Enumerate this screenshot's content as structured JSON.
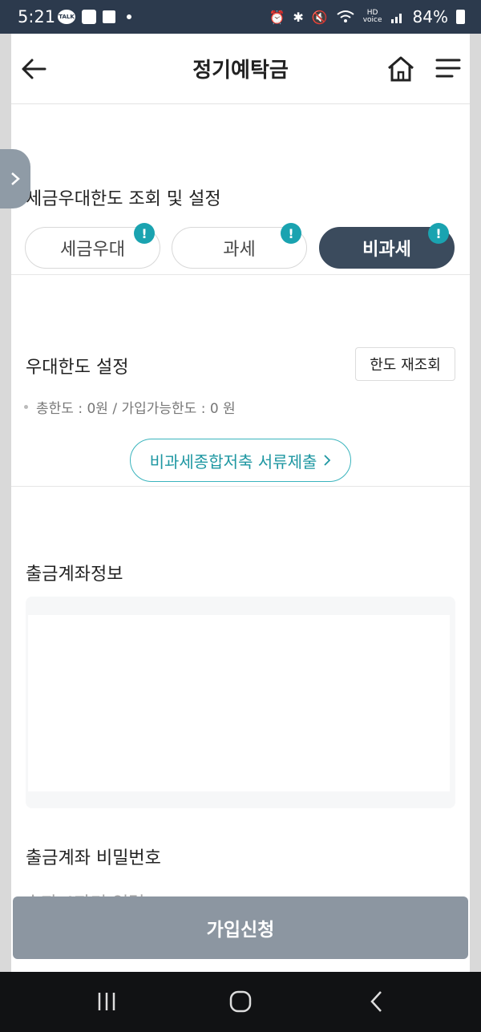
{
  "status_bar": {
    "time": "5:21",
    "battery": "84%",
    "left_icons": [
      "talk-icon",
      "image-icon",
      "flag-icon",
      "dot-icon"
    ],
    "right_icons": [
      "alarm-icon",
      "bluetooth-icon",
      "mute-icon",
      "wifi-icon",
      "hd-voice-icon",
      "signal-icon",
      "battery-icon"
    ]
  },
  "header": {
    "title": "정기예탁금",
    "back_icon": "back-arrow-icon",
    "home_icon": "home-icon",
    "menu_icon": "hamburger-menu-icon"
  },
  "tax_section": {
    "title": "세금우대한도 조회 및 설정",
    "options": [
      {
        "label": "세금우대",
        "selected": false,
        "badge": "!"
      },
      {
        "label": "과세",
        "selected": false,
        "badge": "!"
      },
      {
        "label": "비과세",
        "selected": true,
        "badge": "!"
      }
    ]
  },
  "limit_section": {
    "title": "우대한도 설정",
    "requery_label": "한도 재조회",
    "info": "총한도 : 0원 / 가입가능한도 : 0 원",
    "doc_button_label": "비과세종합저축 서류제출"
  },
  "account_section": {
    "title": "출금계좌정보"
  },
  "password_section": {
    "title": "출금계좌 비밀번호",
    "placeholder": "숫자 4자리 입력",
    "value": ""
  },
  "join_button_label": "가입신청",
  "colors": {
    "accent_teal": "#1aa3b0",
    "selected_button": "#3b4b5d",
    "join_button": "#8c96a1",
    "status_bar": "#2c3a4d"
  }
}
